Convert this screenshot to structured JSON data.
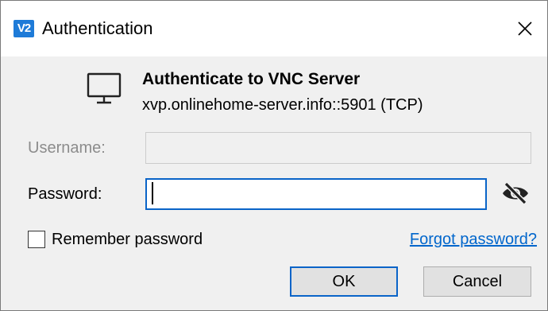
{
  "window": {
    "logo_text": "V2",
    "title": "Authentication",
    "close_icon": "close-icon"
  },
  "header": {
    "icon": "monitor-icon",
    "title": "Authenticate to VNC Server",
    "server": "xvp.onlinehome-server.info::5901 (TCP)"
  },
  "form": {
    "username": {
      "label": "Username:",
      "value": "",
      "enabled": false
    },
    "password": {
      "label": "Password:",
      "value": "",
      "enabled": true,
      "toggle_icon": "eye-slash-icon"
    },
    "remember": {
      "label": "Remember password",
      "checked": false
    },
    "forgot_link": "Forgot password?"
  },
  "buttons": {
    "ok": "OK",
    "cancel": "Cancel"
  },
  "colors": {
    "accent": "#0a64c8",
    "link": "#0066cc",
    "logo": "#1e7bd8",
    "dialog_bg": "#f0f0f0"
  }
}
